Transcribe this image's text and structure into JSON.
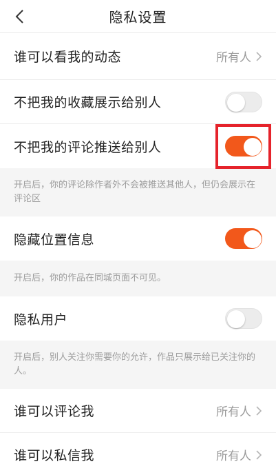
{
  "header": {
    "title": "隐私设置"
  },
  "rows": {
    "who_can_view": {
      "label": "谁可以看我的动态",
      "value": "所有人"
    },
    "hide_favorites": {
      "label": "不把我的收藏展示给别人",
      "on": false
    },
    "hide_comments": {
      "label": "不把我的评论推送给别人",
      "on": true
    },
    "hide_comments_note": "开启后，你的评论除作者外不会被推送其他人，但仍会展示在评论区",
    "hide_location": {
      "label": "隐藏位置信息",
      "on": true
    },
    "hide_location_note": "开启后，你的作品在同城页面不可见。",
    "private_user": {
      "label": "隐私用户",
      "on": false
    },
    "private_user_note": "开启后，别人关注你需要你的允许，作品只展示给已关注你的人。",
    "who_can_comment": {
      "label": "谁可以评论我",
      "value": "所有人"
    },
    "who_can_message": {
      "label": "谁可以私信我",
      "value": "所有人"
    }
  },
  "colors": {
    "accent": "#f2581b",
    "highlight_box": "#e5232b"
  }
}
